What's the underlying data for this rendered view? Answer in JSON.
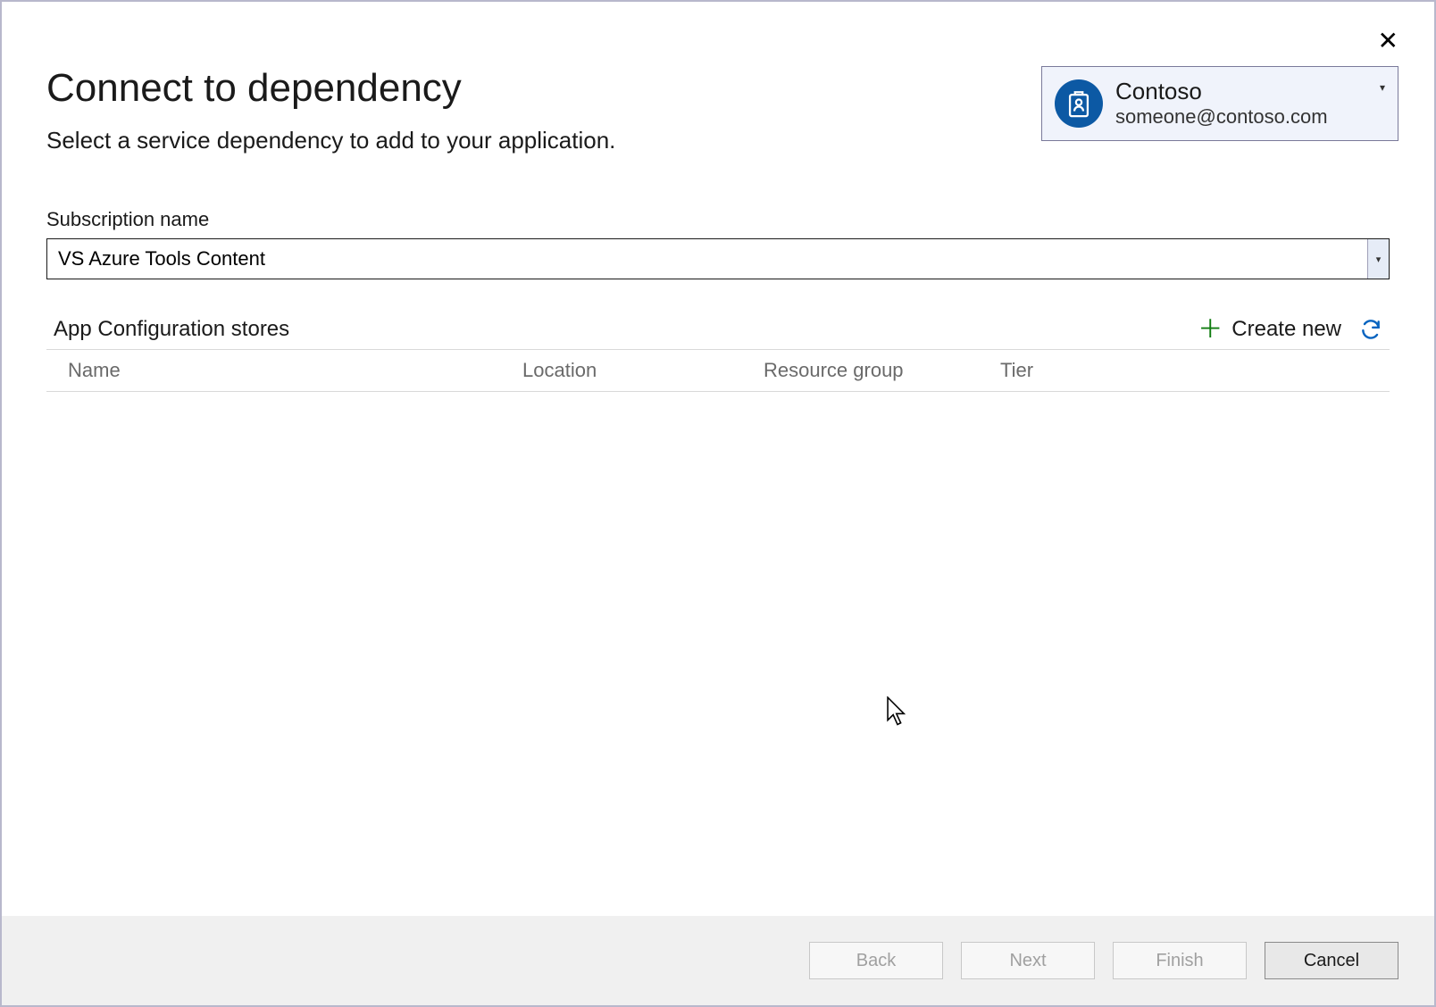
{
  "header": {
    "title": "Connect to dependency",
    "subtitle": "Select a service dependency to add to your application."
  },
  "account": {
    "name": "Contoso",
    "email": "someone@contoso.com"
  },
  "subscription": {
    "label": "Subscription name",
    "value": "VS Azure Tools Content"
  },
  "stores": {
    "title": "App Configuration stores",
    "create_new_label": "Create new",
    "columns": {
      "name": "Name",
      "location": "Location",
      "resource_group": "Resource group",
      "tier": "Tier"
    }
  },
  "footer": {
    "back": "Back",
    "next": "Next",
    "finish": "Finish",
    "cancel": "Cancel"
  }
}
